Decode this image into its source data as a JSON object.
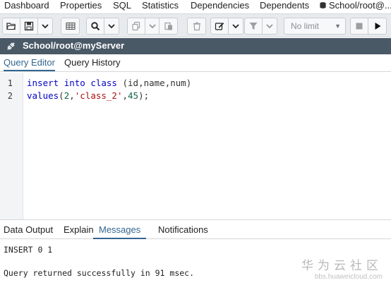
{
  "top_tabs": [
    "Dashboard",
    "Properties",
    "SQL",
    "Statistics",
    "Dependencies",
    "Dependents",
    "School/root@..."
  ],
  "toolbar": {
    "limit_select": "No limit"
  },
  "connection": {
    "title": "School/root@myServer"
  },
  "editor_tabs": [
    "Query Editor",
    "Query History"
  ],
  "editor": {
    "line_numbers": [
      "1",
      "2"
    ],
    "line1": {
      "kw1": "insert",
      "kw2": "into",
      "kw3": "class",
      "rest": " (id,name,num)"
    },
    "line2": {
      "kw1": "values",
      "open": "(",
      "n1": "2",
      "comma1": ",",
      "s1": "'class_2'",
      "comma2": ",",
      "n2": "45",
      "close": ");"
    }
  },
  "bottom_tabs": [
    "Data Output",
    "Explain",
    "Messages",
    "Notifications"
  ],
  "messages": {
    "line1": "INSERT 0 1",
    "line2": "Query returned successfully in 91 msec."
  },
  "watermark": {
    "main": "华为云社区",
    "sub": "bbs.huaweicloud.com"
  },
  "colors": {
    "accent": "#326690",
    "connection_bar": "#4a5966",
    "keyword": "#0000c8",
    "string": "#aa1111"
  }
}
